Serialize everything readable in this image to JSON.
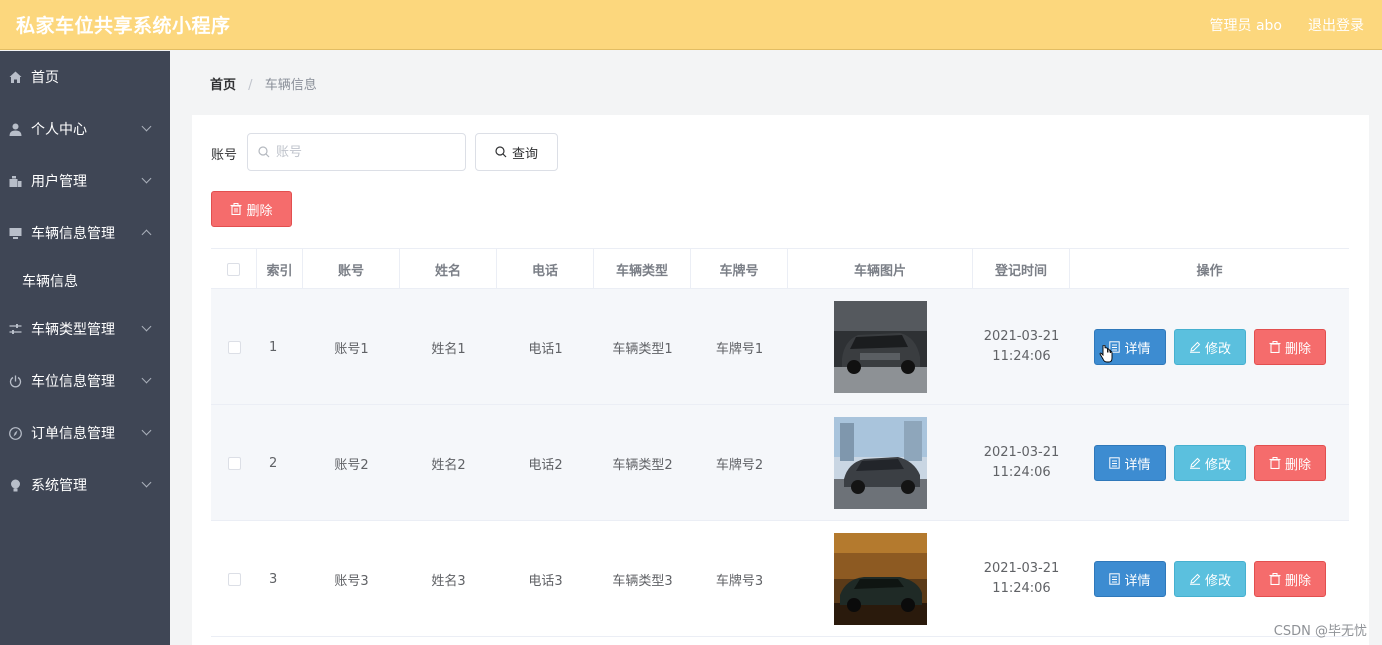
{
  "header": {
    "title": "私家车位共享系统小程序",
    "admin": "管理员 abo",
    "logout": "退出登录"
  },
  "sidebar": {
    "items": [
      {
        "label": "首页",
        "icon": "home-icon"
      },
      {
        "label": "个人中心",
        "icon": "user-icon"
      },
      {
        "label": "用户管理",
        "icon": "users-icon"
      },
      {
        "label": "车辆信息管理",
        "icon": "monitor-icon",
        "submenu": [
          "车辆信息"
        ]
      },
      {
        "label": "车辆类型管理",
        "icon": "sliders-icon"
      },
      {
        "label": "车位信息管理",
        "icon": "power-icon"
      },
      {
        "label": "订单信息管理",
        "icon": "compass-icon"
      },
      {
        "label": "系统管理",
        "icon": "bulb-icon"
      }
    ]
  },
  "breadcrumb": {
    "home": "首页",
    "separator": "/",
    "current": "车辆信息"
  },
  "search": {
    "label": "账号",
    "placeholder": "账号",
    "value": "",
    "button": "查询"
  },
  "bulk_delete": "删除",
  "table": {
    "columns": [
      "索引",
      "账号",
      "姓名",
      "电话",
      "车辆类型",
      "车牌号",
      "车辆图片",
      "登记时间",
      "操作"
    ],
    "rows": [
      {
        "index": "1",
        "account": "账号1",
        "name": "姓名1",
        "phone": "电话1",
        "type": "车辆类型1",
        "plate": "车牌号1",
        "date": "2021-03-21",
        "time": "11:24:06"
      },
      {
        "index": "2",
        "account": "账号2",
        "name": "姓名2",
        "phone": "电话2",
        "type": "车辆类型2",
        "plate": "车牌号2",
        "date": "2021-03-21",
        "time": "11:24:06"
      },
      {
        "index": "3",
        "account": "账号3",
        "name": "姓名3",
        "phone": "电话3",
        "type": "车辆类型3",
        "plate": "车牌号3",
        "date": "2021-03-21",
        "time": "11:24:06"
      }
    ],
    "actions": {
      "detail": "详情",
      "edit": "修改",
      "delete": "删除"
    }
  },
  "watermark": "CSDN @毕无忧",
  "colors": {
    "header": "#fcd77d",
    "sidebar": "#3f4655",
    "primary": "#3d8cd1",
    "info": "#5bc0de",
    "danger": "#f56c6c"
  }
}
